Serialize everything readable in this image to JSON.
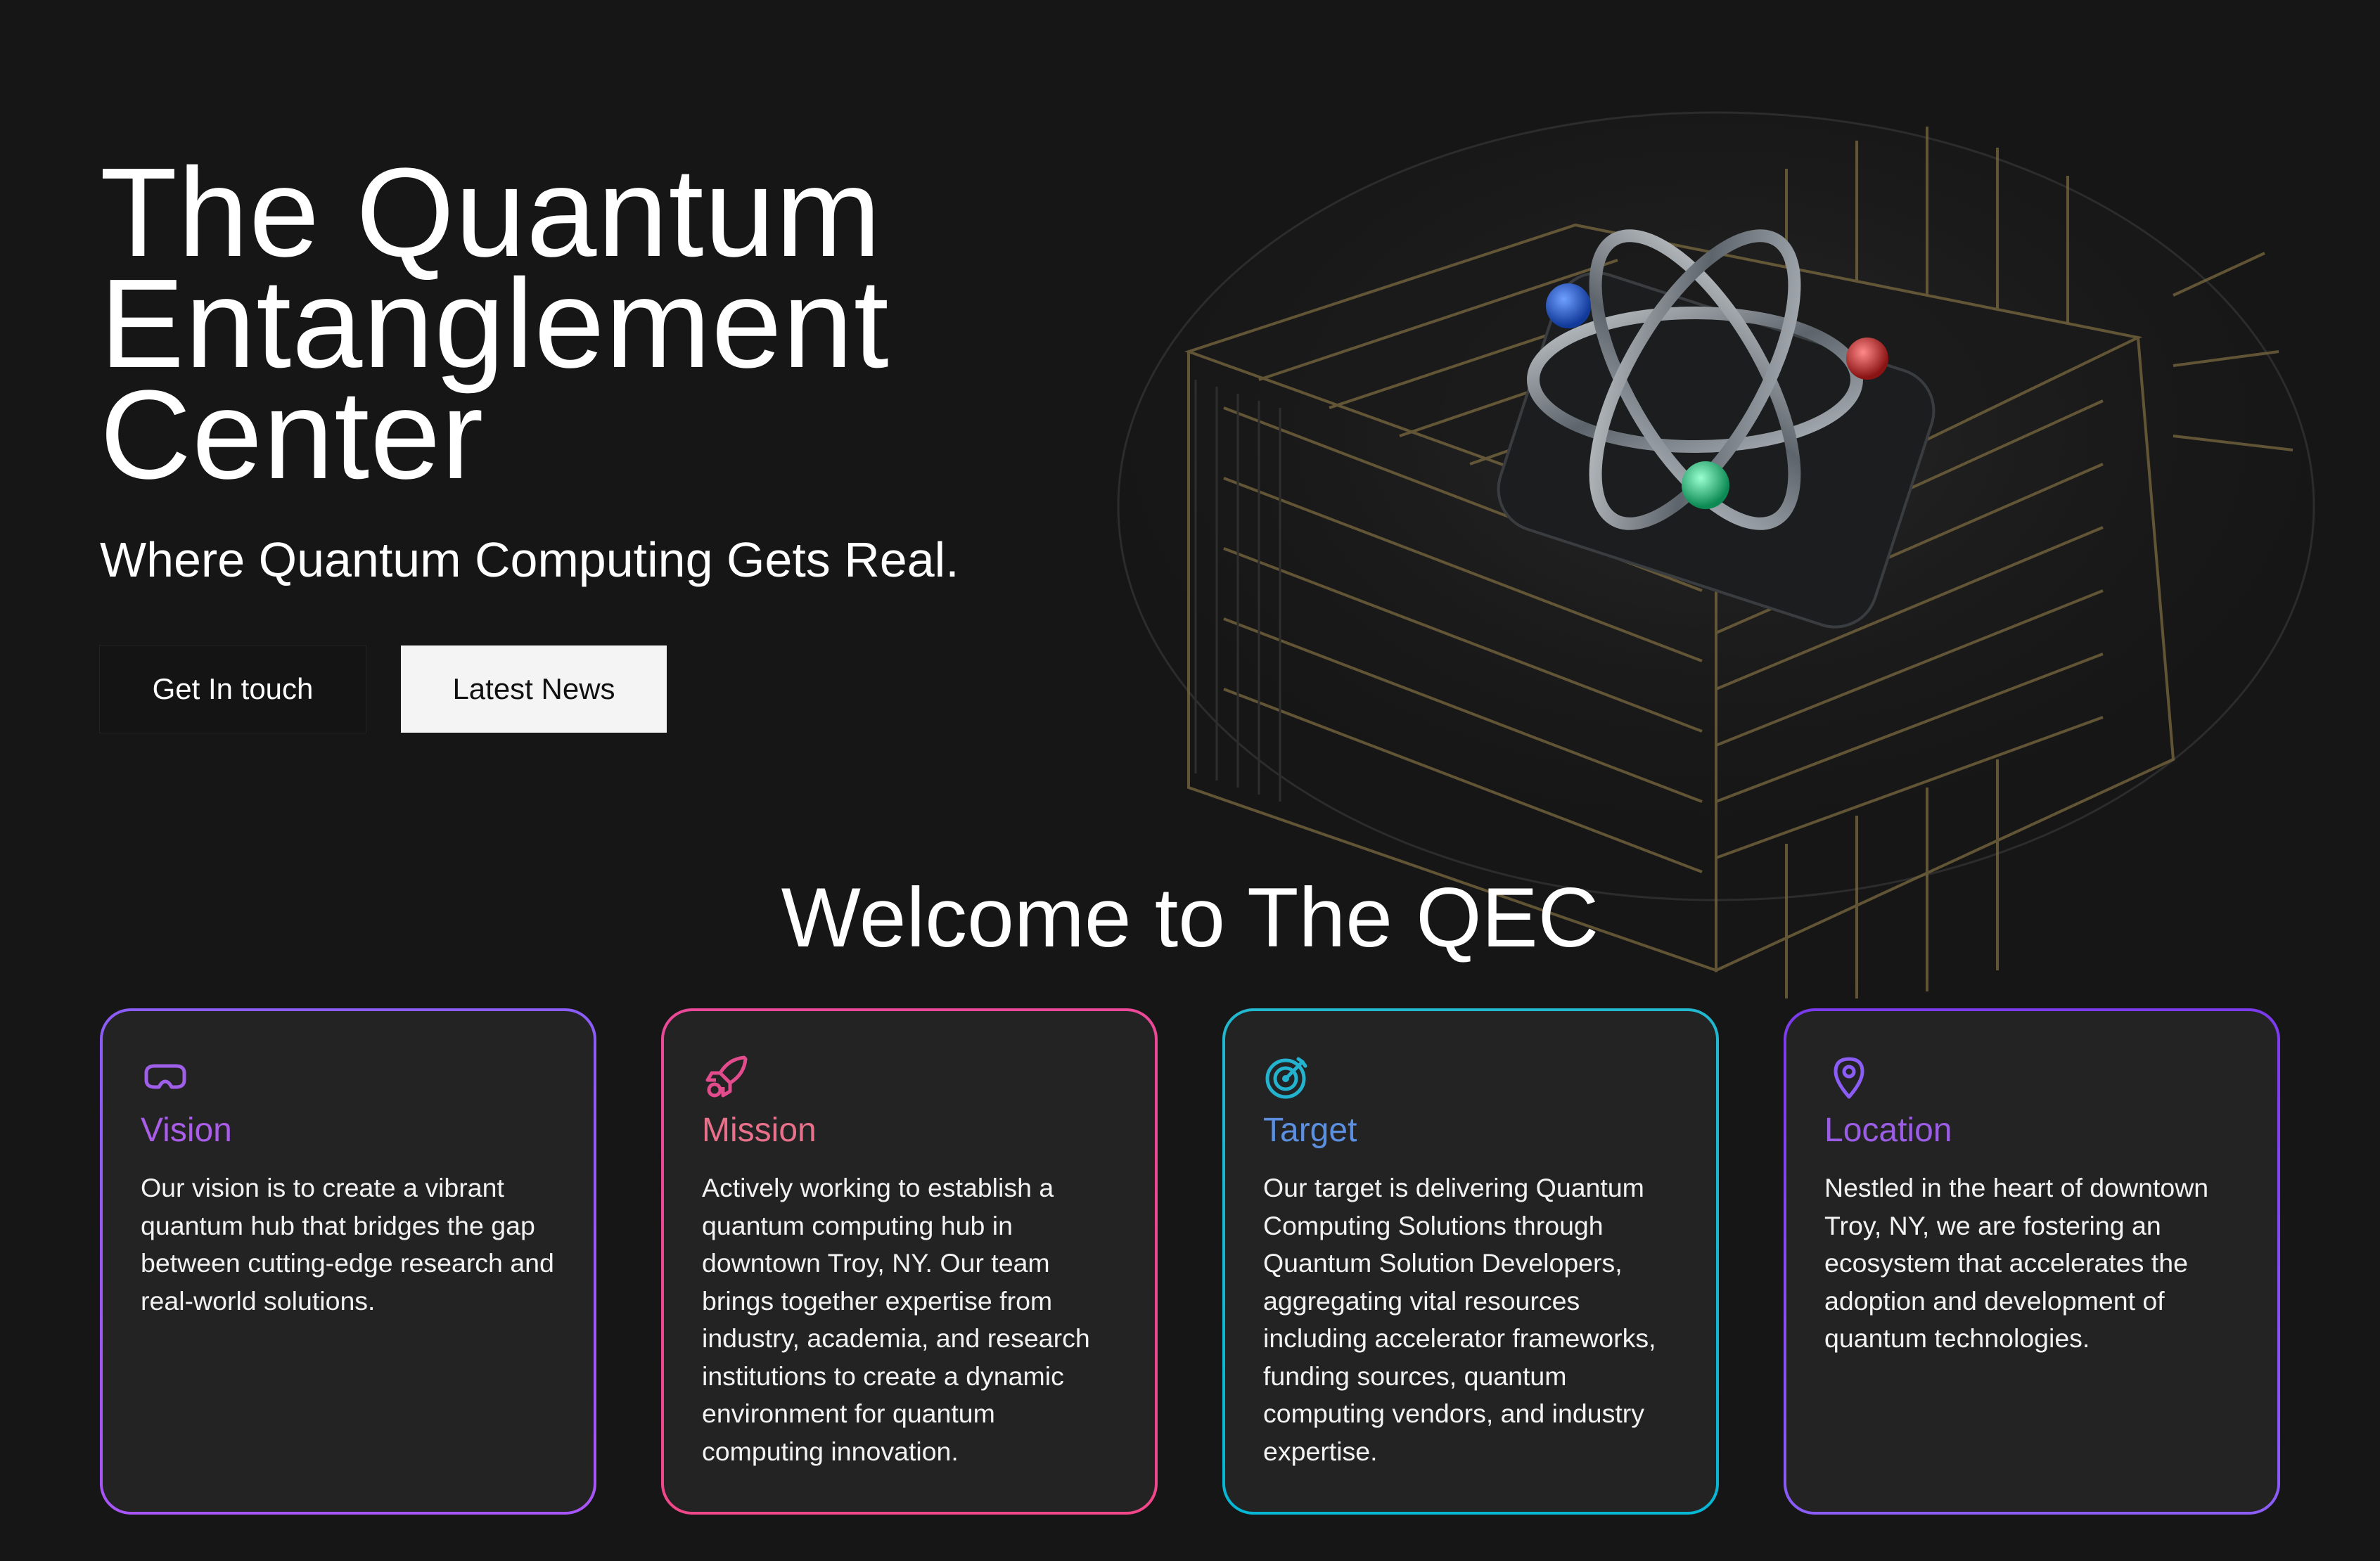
{
  "hero": {
    "title_lines": [
      "The Quantum",
      "Entanglement",
      "Center"
    ],
    "subtitle": "Where Quantum Computing Gets Real.",
    "buttons": {
      "get_in_touch": "Get In touch",
      "latest_news": "Latest News"
    }
  },
  "welcome": {
    "heading": "Welcome to The QEC"
  },
  "cards": [
    {
      "title": "Vision",
      "icon": "vr-headset-icon",
      "text": "Our vision is to create a vibrant quantum hub that bridges the gap between cutting-edge research and real-world solutions.",
      "color": "#a95de8"
    },
    {
      "title": "Mission",
      "icon": "rocket-icon",
      "text": "Actively working to establish a quantum computing hub in downtown Troy, NY. Our team brings together expertise from industry, academia, and research institutions to create a dynamic environment for quantum computing innovation.",
      "color": "#e8708a"
    },
    {
      "title": "Target",
      "icon": "target-icon",
      "text": "Our target is delivering Quantum Computing Solutions through Quantum Solution Developers, aggregating vital resources including accelerator frameworks, funding sources, quantum computing vendors, and industry expertise.",
      "color": "#2fb3d6"
    },
    {
      "title": "Location",
      "icon": "map-pin-icon",
      "text": "Nestled in the heart of downtown Troy, NY, we are fostering an ecosystem that accelerates the adoption and development of quantum technologies.",
      "color": "#9b5de5"
    }
  ],
  "colors": {
    "background": "#161616",
    "card_background": "#232324",
    "vision_gradient": [
      "#8b5cf6",
      "#a855f7"
    ],
    "mission_gradient": [
      "#ec4899",
      "#f0468a"
    ],
    "target_gradient": [
      "#22b8cf",
      "#06b6d4"
    ],
    "location_gradient": [
      "#7c3aed",
      "#8b5cf6"
    ]
  }
}
